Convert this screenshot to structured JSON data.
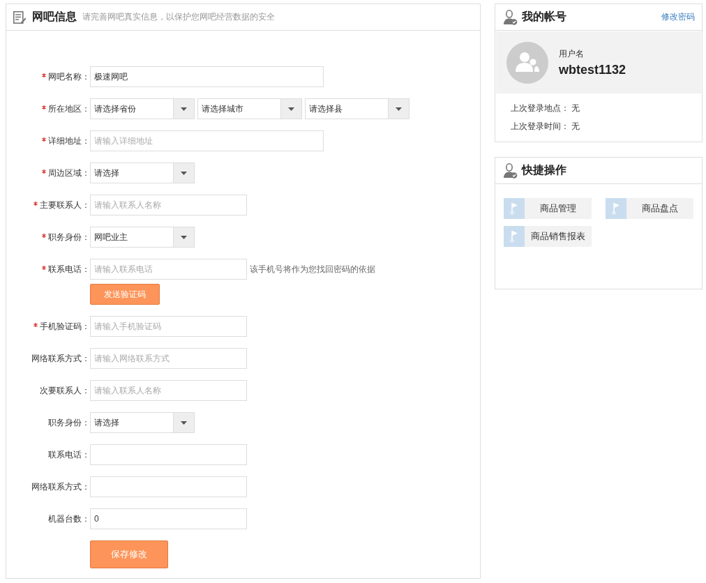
{
  "form_panel": {
    "title": "网吧信息",
    "subtitle": "请完善网吧真实信息，以保护您网吧经营数据的安全",
    "rows": [
      {
        "label": "网吧名称：",
        "required": true,
        "kind": "text",
        "value": "极速网吧"
      },
      {
        "label": "所在地区：",
        "required": true,
        "kind": "selects",
        "options": [
          "请选择省份",
          "请选择城市",
          "请选择县"
        ]
      },
      {
        "label": "详细地址：",
        "required": true,
        "kind": "text",
        "placeholder": "请输入详细地址"
      },
      {
        "label": "周边区域：",
        "required": true,
        "kind": "select",
        "value": "请选择"
      },
      {
        "label": "主要联系人：",
        "required": true,
        "kind": "text",
        "placeholder": "请输入联系人名称"
      },
      {
        "label": "职务身份：",
        "required": true,
        "kind": "select",
        "value": "网吧业主"
      },
      {
        "label": "联系电话：",
        "required": true,
        "kind": "text",
        "placeholder": "请输入联系电话",
        "hint": "该手机号将作为您找回密码的依据",
        "button": "发送验证码"
      },
      {
        "label": "手机验证码：",
        "required": true,
        "kind": "text",
        "placeholder": "请输入手机验证码"
      },
      {
        "label": "网络联系方式：",
        "required": false,
        "kind": "text",
        "placeholder": "请输入网络联系方式"
      },
      {
        "label": "次要联系人：",
        "required": false,
        "kind": "text",
        "placeholder": "请输入联系人名称"
      },
      {
        "label": "职务身份：",
        "required": false,
        "kind": "select",
        "value": "请选择"
      },
      {
        "label": "联系电话：",
        "required": false,
        "kind": "text"
      },
      {
        "label": "网络联系方式：",
        "required": false,
        "kind": "text"
      },
      {
        "label": "机器台数：",
        "required": false,
        "kind": "text",
        "value": "0"
      }
    ],
    "save_button": "保存修改"
  },
  "account_panel": {
    "title": "我的帐号",
    "link": "修改密码",
    "username_label": "用户名",
    "username": "wbtest1132",
    "info": [
      {
        "label": "上次登录地点：",
        "value": "无"
      },
      {
        "label": "上次登录时间：",
        "value": "无"
      }
    ]
  },
  "quick_panel": {
    "title": "快捷操作",
    "items": [
      "商品管理",
      "商品盘点",
      "商品销售报表"
    ]
  }
}
